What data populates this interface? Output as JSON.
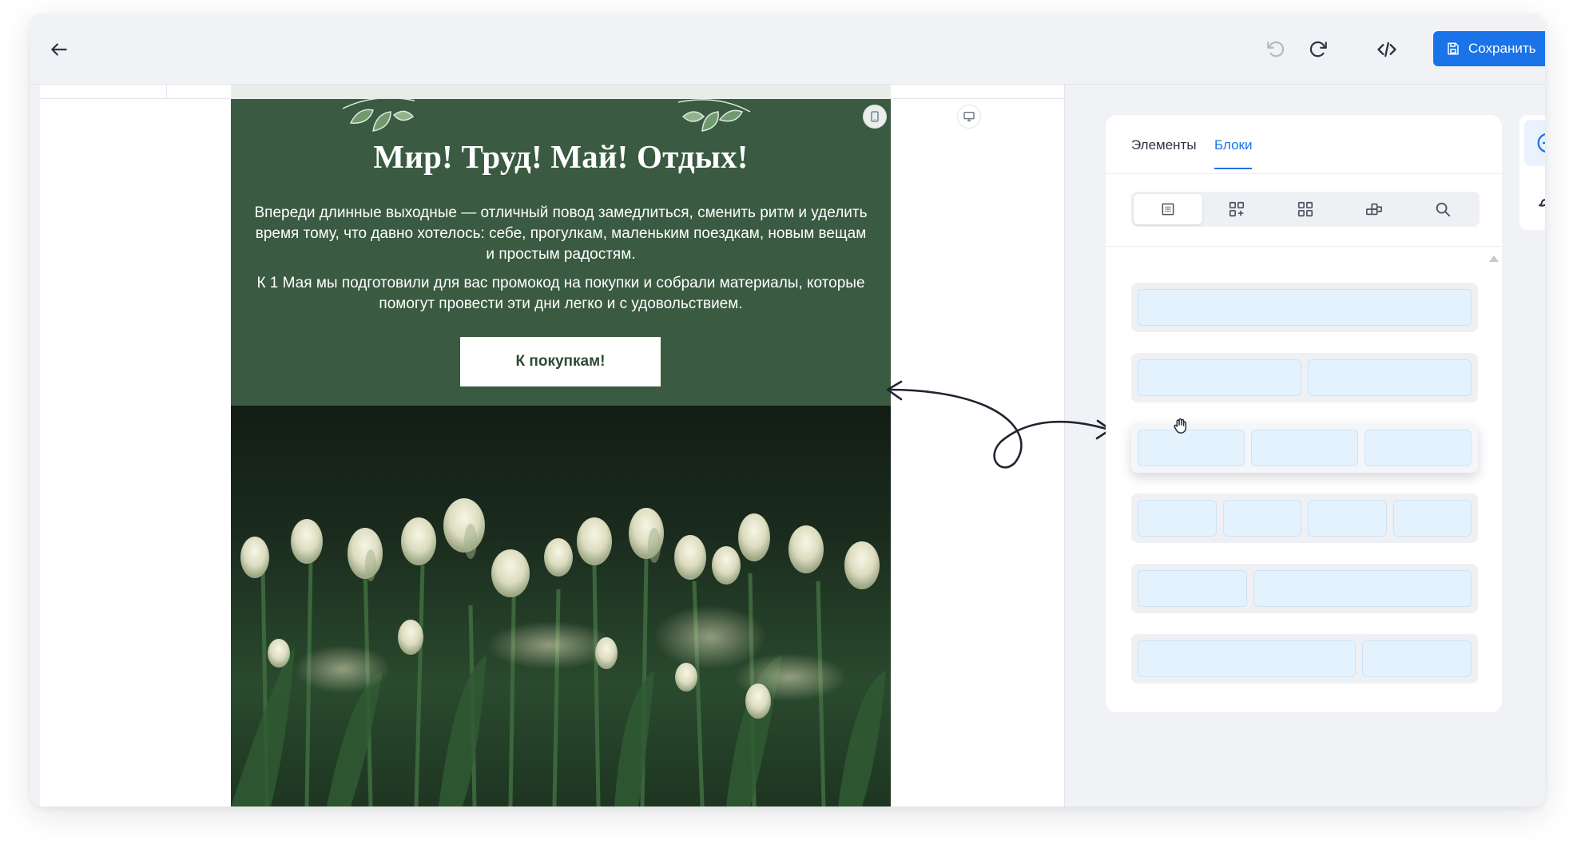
{
  "toolbar": {
    "back_icon": "arrow-left-icon",
    "undo_icon": "undo-icon",
    "redo_icon": "redo-icon",
    "code_icon": "code-icon",
    "save_label": "Сохранить",
    "accent": "#1a73e8"
  },
  "email": {
    "title": "Мир! Труд! Май! Отдых!",
    "paragraph_1": "Впереди длинные выходные — отличный повод замедлиться, сменить ритм и уделить время тому, что давно хотелось: себе, прогулкам, маленьким поездкам, новым вещам и простым радостям.",
    "paragraph_2": "К 1 Мая мы подготовили для вас промокод на покупки и собрали материалы, которые помогут провести эти дни легко и с удовольствием.",
    "cta_label": "К покупкам!",
    "bg_color": "#3a5a41"
  },
  "panel": {
    "tabs": [
      {
        "label": "Элементы",
        "active": false
      },
      {
        "label": "Блоки",
        "active": true
      }
    ],
    "segments": [
      "grid-dotted-icon",
      "grid-add-icon",
      "grid-four-icon",
      "grid-stack-icon",
      "search-icon"
    ],
    "layouts": [
      {
        "columns": [
          1
        ]
      },
      {
        "columns": [
          1,
          1
        ]
      },
      {
        "columns": [
          1,
          1,
          1
        ],
        "dragging": true
      },
      {
        "columns": [
          1,
          1,
          1,
          1
        ]
      },
      {
        "columns": [
          1,
          2
        ]
      },
      {
        "columns": [
          2,
          1
        ]
      }
    ]
  },
  "sidetools": [
    "plus-circle-icon",
    "brush-icon"
  ]
}
